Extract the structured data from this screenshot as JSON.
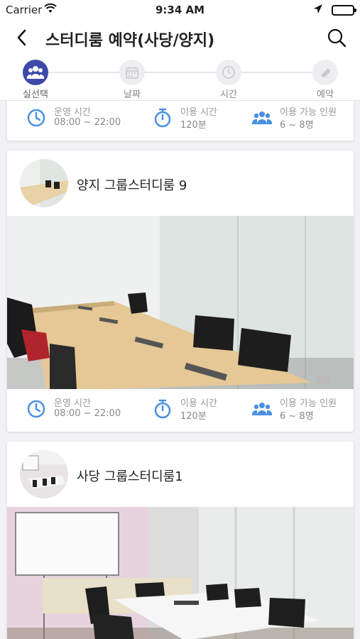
{
  "status": {
    "carrier": "Carrier",
    "time": "9:34 AM"
  },
  "nav": {
    "title": "스터디룸 예약(사당/양지)"
  },
  "steps": [
    {
      "label": "실선택",
      "icon": "people-icon",
      "active": true
    },
    {
      "label": "날짜",
      "icon": "calendar-icon",
      "active": false
    },
    {
      "label": "시간",
      "icon": "clock-icon",
      "active": false
    },
    {
      "label": "예약",
      "icon": "ticket-icon",
      "active": false
    }
  ],
  "info_labels": {
    "hours": "운영 시간",
    "usage": "이용 시간",
    "capacity": "이용 가능 인원"
  },
  "rooms": [
    {
      "name": "",
      "hours": "08:00 ~ 22:00",
      "usage": "120분",
      "capacity": "6 ~ 8명"
    },
    {
      "name": "양지 그룹스터디룸 9",
      "hours": "08:00 ~ 22:00",
      "usage": "120분",
      "capacity": "6 ~ 8명"
    },
    {
      "name": "사당 그룹스터디룸1"
    }
  ],
  "colors": {
    "accent": "#3d4aa8",
    "icon_blue": "#4a90e2"
  }
}
